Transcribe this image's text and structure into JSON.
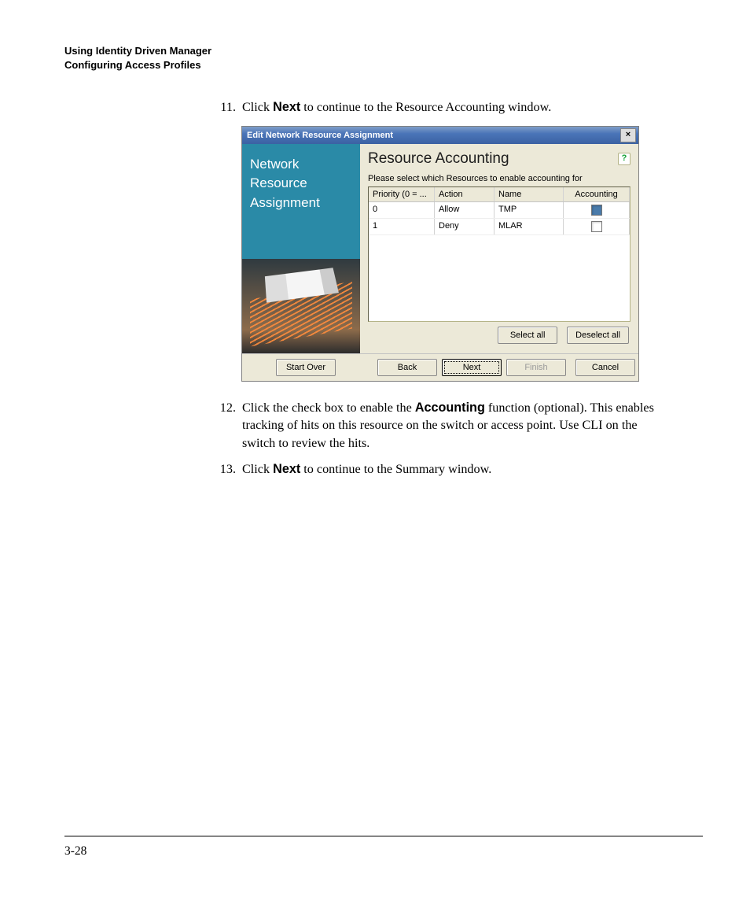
{
  "header": {
    "line1": "Using Identity Driven Manager",
    "line2": "Configuring Access Profiles"
  },
  "steps": [
    {
      "num": "11.",
      "parts": [
        {
          "t": "Click "
        },
        {
          "t": "Next",
          "bold": true
        },
        {
          "t": " to continue to the Resource Accounting window."
        }
      ]
    },
    {
      "num": "12.",
      "parts": [
        {
          "t": "Click the check box to enable the "
        },
        {
          "t": "Accounting",
          "bold": true
        },
        {
          "t": " function (optional). This enables tracking of hits on this resource on the switch or access point. Use CLI on the switch to review the hits."
        }
      ]
    },
    {
      "num": "13.",
      "parts": [
        {
          "t": "Click "
        },
        {
          "t": "Next",
          "bold": true
        },
        {
          "t": " to continue to the Summary window."
        }
      ]
    }
  ],
  "dialog": {
    "title": "Edit Network Resource Assignment",
    "wizard_label": "Network Resource Assignment",
    "panel_title": "Resource Accounting",
    "subtitle": "Please select which Resources to enable accounting for",
    "columns": {
      "c1": "Priority (0 = ...",
      "c2": "Action",
      "c3": "Name",
      "c4": "Accounting"
    },
    "rows": [
      {
        "priority": "0",
        "action": "Allow",
        "name": "TMP",
        "checked": true
      },
      {
        "priority": "1",
        "action": "Deny",
        "name": "MLAR",
        "checked": false
      }
    ],
    "buttons": {
      "select_all": "Select all",
      "deselect_all": "Deselect all",
      "start_over": "Start Over",
      "back": "Back",
      "next": "Next",
      "finish": "Finish",
      "cancel": "Cancel"
    }
  },
  "page_number": "3-28"
}
